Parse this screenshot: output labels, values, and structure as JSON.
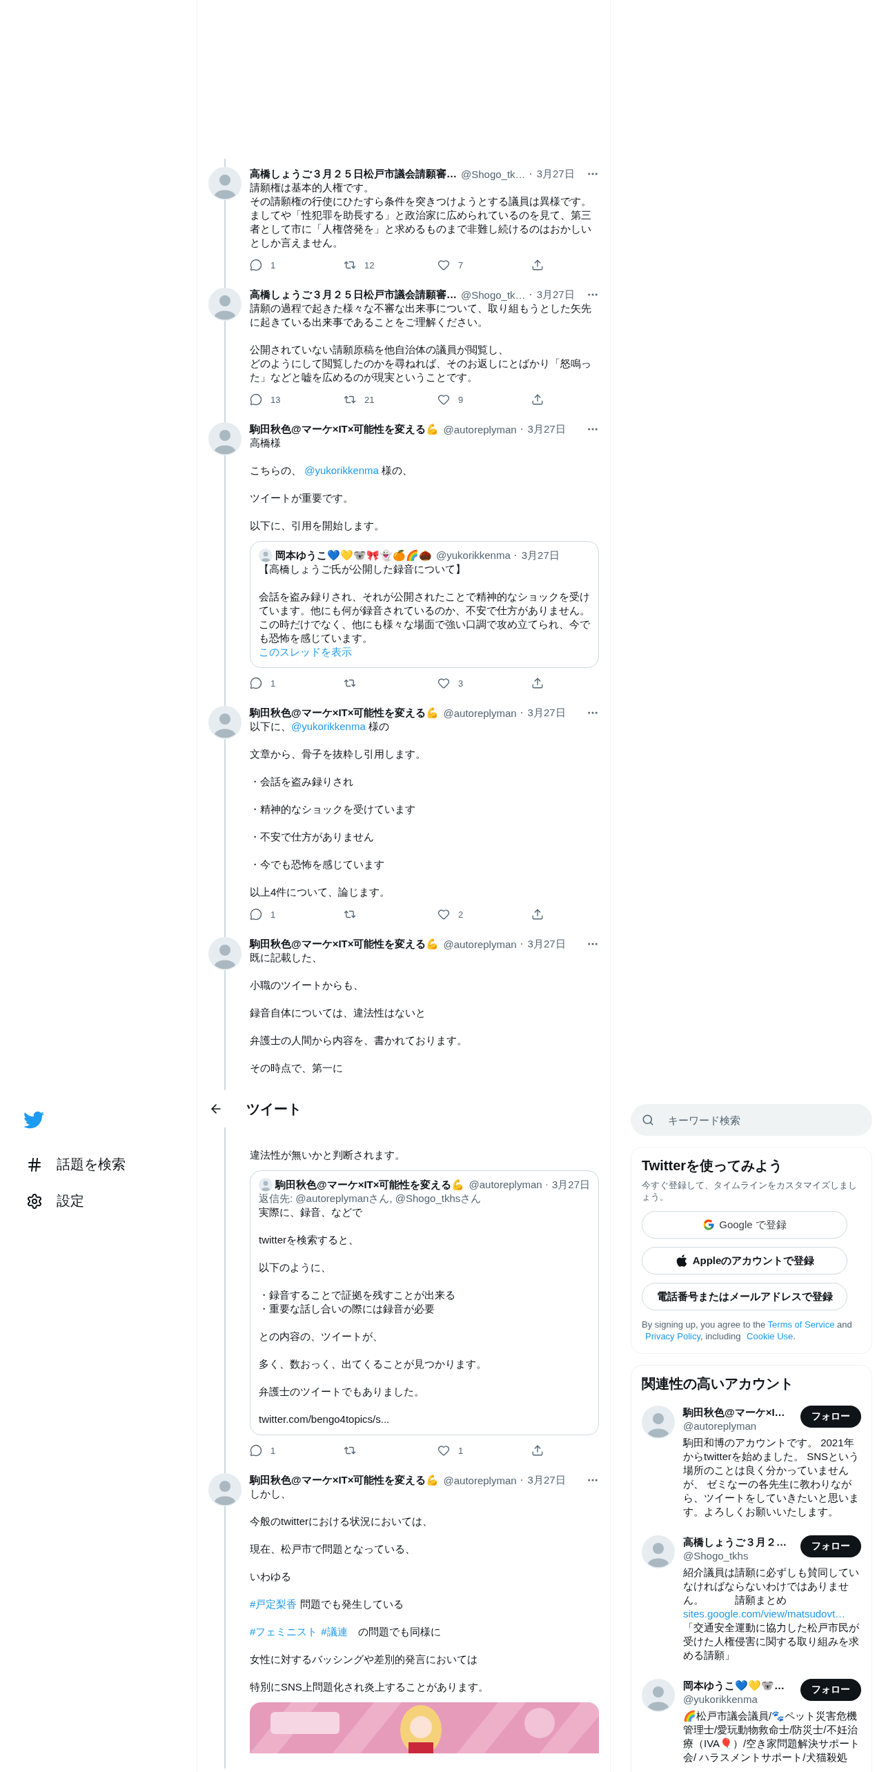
{
  "nav": {
    "items": [
      {
        "label": "話題を検索",
        "kind": "explore"
      },
      {
        "label": "設定",
        "kind": "settings"
      }
    ]
  },
  "timeline": [
    {
      "kind": "tweet",
      "name": "高橋しょうご３月２５日松戸市議会請願審…",
      "handle": "@Shogo_tk…",
      "date": "3月27日",
      "body": [
        {
          "kind": "lines",
          "lines": [
            "請願権は基本的人権です。",
            "その請願権の行使にひたすら条件を突きつけようとする議員は異様です。",
            "ましてや「性犯罪を助長する」と政治家に広められているのを見て、第三者として市に「人権啓発を」と求めるものまで非難し続けるのはおかしいとしか言えません。"
          ]
        }
      ],
      "actions": {
        "reply": "1",
        "retweet": "12",
        "like": "7"
      }
    },
    {
      "kind": "tweet",
      "name": "高橋しょうご３月２５日松戸市議会請願審…",
      "handle": "@Shogo_tk…",
      "date": "3月27日",
      "body": [
        {
          "kind": "text",
          "text": "請願の過程で起きた様々な不審な出来事について、取り組もうとした矢先に起きている出来事であることをご理解ください。"
        },
        {
          "kind": "lines",
          "lines": [
            "公開されていない請願原稿を他自治体の議員が閲覧し、",
            "どのようにして閲覧したのかを尋ねれば、そのお返しにとばかり「怒鳴った」などと嘘を広めるのが現実ということです。"
          ]
        }
      ],
      "actions": {
        "reply": "13",
        "retweet": "21",
        "like": "9"
      }
    },
    {
      "kind": "tweet",
      "name": "駒田秋色@マーケ×IT×可能性を変える💪",
      "handle": "@autoreplyman",
      "date": "3月27日",
      "body": [
        {
          "kind": "text",
          "text": "高橋様"
        },
        {
          "kind": "rich",
          "runs": [
            {
              "kind": "plain",
              "text": "こちらの、 "
            },
            {
              "kind": "link",
              "text": "@yukorikkenma"
            },
            {
              "kind": "plain",
              "text": " 様の、"
            }
          ]
        },
        {
          "kind": "text",
          "text": "ツイートが重要です。"
        },
        {
          "kind": "text",
          "text": "以下に、引用を開始します。"
        },
        {
          "kind": "quote",
          "name": "岡本ゆうこ💙💛🐨🎀👻🍊🌈🌰",
          "handle": "@yukorikkenma",
          "date": "3月27日",
          "body": [
            {
              "kind": "text",
              "text": "【高橋しょうご氏が公開した録音について】"
            },
            {
              "kind": "text",
              "text": "会話を盗み録りされ、それが公開されたことで精神的なショックを受けています。他にも何が録音されているのか、不安で仕方がありません。この時だけでなく、他にも様々な場面で強い口調で攻め立てられ、今でも恐怖を感じています。"
            },
            {
              "kind": "thread_link",
              "text": "このスレッドを表示"
            }
          ]
        }
      ],
      "actions": {
        "reply": "1",
        "like": "3"
      }
    },
    {
      "kind": "tweet",
      "name": "駒田秋色@マーケ×IT×可能性を変える💪",
      "handle": "@autoreplyman",
      "date": "3月27日",
      "body": [
        {
          "kind": "rich",
          "runs": [
            {
              "kind": "plain",
              "text": "以下に、"
            },
            {
              "kind": "link",
              "text": "@yukorikkenma"
            },
            {
              "kind": "plain",
              "text": " 様の"
            }
          ]
        },
        {
          "kind": "text",
          "text": "文章から、骨子を抜粋し引用します。"
        },
        {
          "kind": "text",
          "text": "・会話を盗み録りされ"
        },
        {
          "kind": "text",
          "text": "・精神的なショックを受けています"
        },
        {
          "kind": "text",
          "text": "・不安で仕方がありません"
        },
        {
          "kind": "text",
          "text": "・今でも恐怖を感じています"
        },
        {
          "kind": "text",
          "text": "以上4件について、論じます。"
        }
      ],
      "actions": {
        "reply": "1",
        "like": "2"
      }
    },
    {
      "kind": "tweet",
      "name": "駒田秋色@マーケ×IT×可能性を変える💪",
      "handle": "@autoreplyman",
      "date": "3月27日",
      "body": [
        {
          "kind": "text",
          "text": "既に記載した、"
        },
        {
          "kind": "text",
          "text": "小職のツイートからも、"
        },
        {
          "kind": "text",
          "text": "録音自体については、違法性はないと"
        },
        {
          "kind": "text",
          "text": "弁護士の人間から内容を、書かれております。"
        },
        {
          "kind": "text",
          "text": "その時点で、第一に"
        }
      ]
    },
    {
      "kind": "header",
      "title": "ツイート"
    },
    {
      "kind": "continuation",
      "body": [
        {
          "kind": "text",
          "text": "違法性が無いかと判断されます。"
        },
        {
          "kind": "quote",
          "name": "駒田秋色@マーケ×IT×可能性を変える💪",
          "handle": "@autoreplyman",
          "date": "3月27日",
          "reply_to": "返信先: @autoreplymanさん, @Shogo_tkhsさん",
          "body": [
            {
              "kind": "text",
              "text": "実際に、録音、などで"
            },
            {
              "kind": "text",
              "text": "twitterを検索すると、"
            },
            {
              "kind": "text",
              "text": "以下のように、"
            },
            {
              "kind": "lines",
              "lines": [
                "・録音することで証拠を残すことが出来る",
                "・重要な話し合いの際には録音が必要"
              ]
            },
            {
              "kind": "text",
              "text": "との内容の、ツイートが、"
            },
            {
              "kind": "text",
              "text": "多く、数おっく、出てくることが見つかります。"
            },
            {
              "kind": "text",
              "text": "弁護士のツイートでもありました。"
            },
            {
              "kind": "text",
              "text": "twitter.com/bengo4topics/s..."
            }
          ]
        }
      ],
      "actions": {
        "reply": "1",
        "like": "1"
      }
    },
    {
      "kind": "tweet",
      "name": "駒田秋色@マーケ×IT×可能性を変える💪",
      "handle": "@autoreplyman",
      "date": "3月27日",
      "body": [
        {
          "kind": "text",
          "text": "しかし、"
        },
        {
          "kind": "text",
          "text": "今般のtwitterにおける状況においては、"
        },
        {
          "kind": "text",
          "text": "現在、松戸市で問題となっている、"
        },
        {
          "kind": "text",
          "text": "いわゆる"
        },
        {
          "kind": "rich",
          "runs": [
            {
              "kind": "link",
              "text": "#戸定梨香"
            },
            {
              "kind": "plain",
              "text": " 問題でも発生している"
            }
          ]
        },
        {
          "kind": "rich",
          "runs": [
            {
              "kind": "link",
              "text": "#フェミニスト"
            },
            {
              "kind": "link",
              "text": "#議連"
            },
            {
              "kind": "plain",
              "text": "　の問題でも同様に"
            }
          ]
        },
        {
          "kind": "text",
          "text": "女性に対するバッシングや差別的発言においては"
        },
        {
          "kind": "text",
          "text": "特別にSNS上問題化され炎上することがあります。"
        },
        {
          "kind": "picture"
        }
      ]
    }
  ],
  "search": {
    "placeholder": "キーワード検索"
  },
  "signup": {
    "title": "Twitterを使ってみよう",
    "subtitle": "今すぐ登録して、タイムラインをカスタマイズしましょう。",
    "buttons": [
      {
        "label": "Google で登録",
        "kind": "google"
      },
      {
        "label": "Appleのアカウントで登録",
        "kind": "apple"
      },
      {
        "label": "電話番号またはメールアドレスで登録",
        "kind": "phone"
      }
    ],
    "legal": [
      {
        "kind": "plain",
        "text": "By signing up, you agree to the "
      },
      {
        "kind": "link",
        "text": "Terms of Service"
      },
      {
        "kind": "plain",
        "text": " and "
      },
      {
        "kind": "link",
        "text": "Privacy Policy"
      },
      {
        "kind": "plain",
        "text": ", including "
      },
      {
        "kind": "link",
        "text": "Cookie Use"
      },
      {
        "kind": "plain",
        "text": "."
      }
    ]
  },
  "related": {
    "title": "関連性の高いアカウント",
    "accounts": [
      {
        "name": "駒田秋色@マーケ×I…",
        "handle": "@autoreplyman",
        "button": "フォロー",
        "bio": [
          {
            "kind": "plain",
            "text": "駒田和博のアカウントです。 2021年からtwitterを始めました。 SNSという場所のことは良く分かっていませんが、 ゼミなーの各先生に教わりながら、ツイートをしていきたいと思います。よろしくお願いいたします。"
          }
        ]
      },
      {
        "name": "高橋しょうご３月２…",
        "handle": "@Shogo_tkhs",
        "button": "フォロー",
        "bio": [
          {
            "kind": "plain",
            "text": "紹介議員は請願に必ずしも賛同していなければならないわけではありません。　　　請願まとめ"
          },
          {
            "kind": "link",
            "text": "sites.google.com/view/matsudovt…"
          },
          {
            "kind": "plain",
            "text": "「交通安全運動に協力した松戸市民が受けた人権侵害に関する取り組みを求める請願」"
          }
        ]
      },
      {
        "name": "岡本ゆうこ💙💛🐨…",
        "handle": "@yukorikkenma",
        "button": "フォロー",
        "bio": [
          {
            "kind": "plain",
            "text": "🌈松戸市議会議員/🐾ペット災害危機管理士/愛玩動物救命士/防災士/不妊治療（IVA🎈）/空き家問題解決サポート会/ ハラスメントサポート/犬猫殺処"
          }
        ]
      }
    ]
  }
}
